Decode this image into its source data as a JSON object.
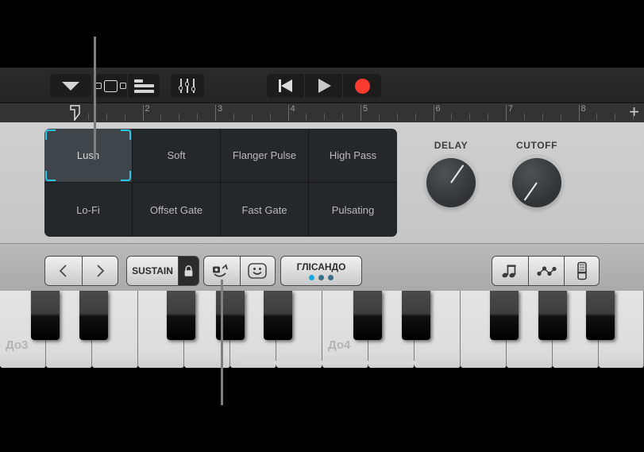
{
  "toolbar": {
    "view_caret": "library-caret",
    "icons": {
      "browser": "browser-icon",
      "tracks": "track-list-icon",
      "mixer": "mixer-icon",
      "rewind": "rewind-icon",
      "play": "play-icon",
      "record": "record-icon",
      "metronome": "metronome-icon",
      "tuner": "tuner-icon",
      "settings": "gear-icon"
    },
    "record_color": "#fb3b30",
    "tuner_color": "#0a84ff"
  },
  "ruler": {
    "marks": [
      "2",
      "3",
      "4",
      "5",
      "6",
      "7",
      "8"
    ],
    "add_label": "+"
  },
  "presets": {
    "items": [
      {
        "label": "Lush",
        "selected": true
      },
      {
        "label": "Soft",
        "selected": false
      },
      {
        "label": "Flanger Pulse",
        "selected": false
      },
      {
        "label": "High Pass",
        "selected": false
      },
      {
        "label": "Lo-Fi",
        "selected": false
      },
      {
        "label": "Offset Gate",
        "selected": false
      },
      {
        "label": "Fast Gate",
        "selected": false
      },
      {
        "label": "Pulsating",
        "selected": false
      }
    ],
    "selection_color": "#27c4e0",
    "next_page_label": "next-page-chevron"
  },
  "knobs": [
    {
      "label": "DELAY",
      "angle": -145
    },
    {
      "label": "CUTOFF",
      "angle": 35
    }
  ],
  "keyboard_bar": {
    "octave_down": "chevron-left",
    "octave_up": "chevron-right",
    "sustain_label": "SUSTAIN",
    "lock_icon": "lock-icon",
    "pitch_icon": "pitch-bend-icon",
    "expression_icon": "smiley-face-icon",
    "glissando_label": "ГЛІСАНДО",
    "glissando_dots": [
      "#18a7e0",
      "#3a6d86",
      "#3a6d86"
    ],
    "arpeggiator_icon": "eighth-notes-icon",
    "scale_icon": "note-dots-icon",
    "velocity_icon": "fader-icon"
  },
  "piano": {
    "labels": {
      "c3": "До3",
      "c4": "До4"
    }
  }
}
